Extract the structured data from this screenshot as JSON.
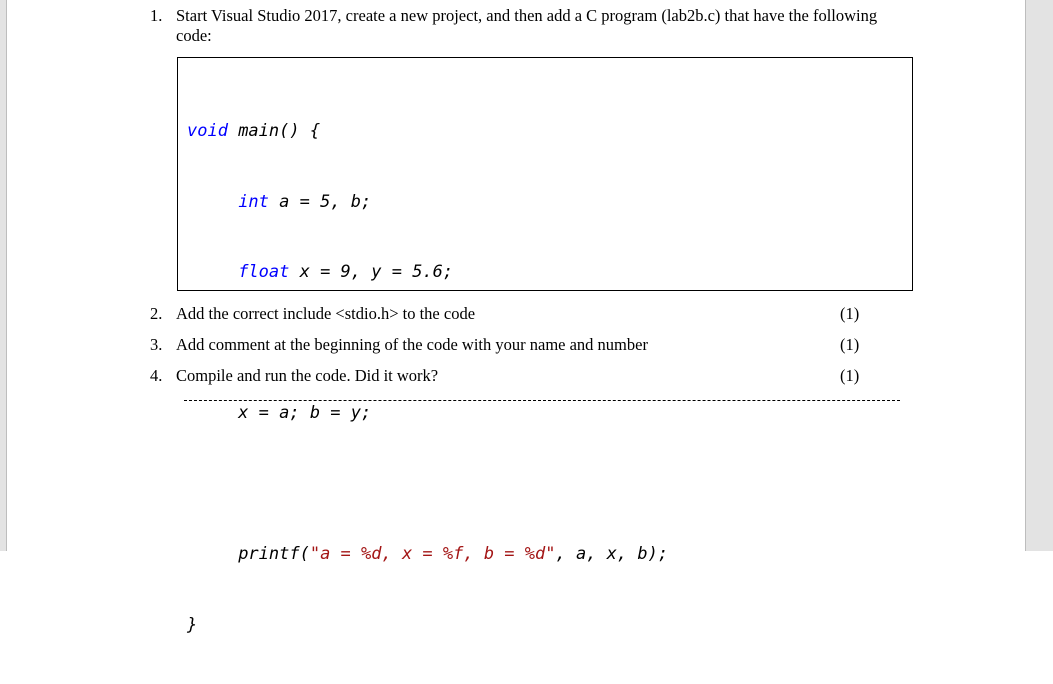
{
  "document": {
    "questions": [
      {
        "number": "1.",
        "text": "Start Visual Studio 2017, create a new project, and then add a C program (lab2b.c) that have the following code:",
        "marks": ""
      },
      {
        "number": "2.",
        "text": "Add the correct include <stdio.h> to the code",
        "marks": "(1)"
      },
      {
        "number": "3.",
        "text": "Add comment at the beginning of the code with your name and number",
        "marks": "(1)"
      },
      {
        "number": "4.",
        "text": "Compile and run the code. Did it work?",
        "marks": "(1)"
      }
    ],
    "code": {
      "line1": {
        "kw": "void",
        "rest": " main() {"
      },
      "line2": {
        "indent": "     ",
        "kw": "int",
        "rest": " a = 5, b;"
      },
      "line3": {
        "indent": "     ",
        "kw": "float",
        "rest": " x = 9, y = 5.6;"
      },
      "line4": "",
      "line5": "     x = a; b = y;",
      "line6": "",
      "line7": {
        "indent": "     ",
        "pre": "printf(",
        "str": "\"a = %d, x = %f, b = %d\"",
        "post": ", a, x, b);"
      },
      "line8": "}"
    },
    "answer_line": "dashed"
  },
  "colors": {
    "keyword": "#0000ff",
    "string": "#a31515",
    "sidebar": "#e3e3e3"
  }
}
